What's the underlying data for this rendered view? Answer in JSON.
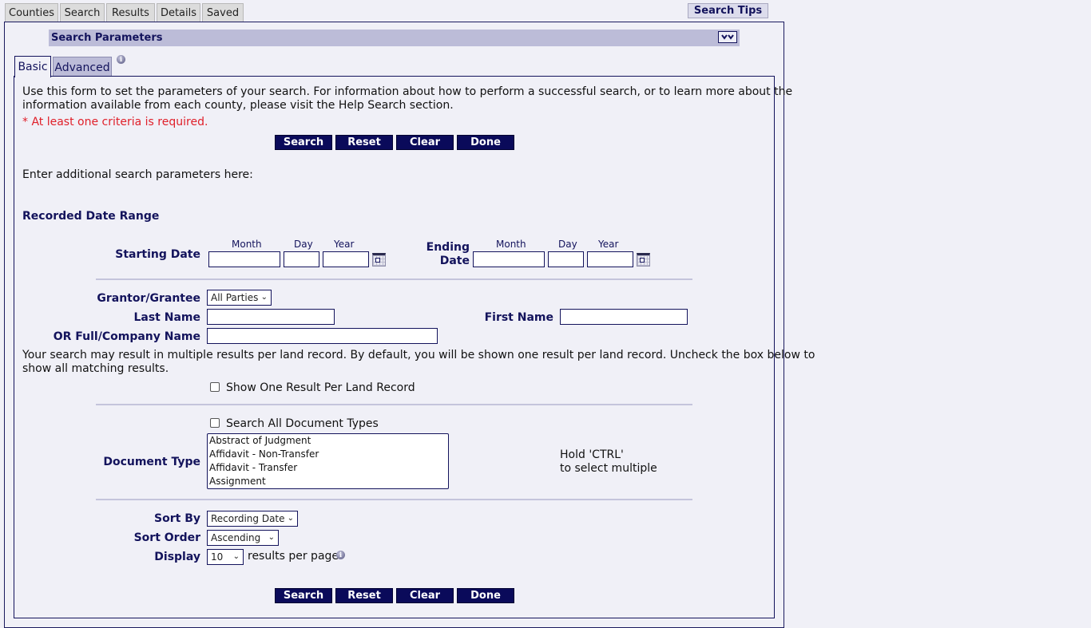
{
  "top_tabs": [
    "Counties",
    "Search",
    "Results",
    "Details",
    "Saved"
  ],
  "search_tips_label": "Search Tips",
  "section": {
    "title": "Search Parameters",
    "collapse_icon": "double-chevron-down-icon"
  },
  "sub_tabs": [
    "Basic",
    "Advanced"
  ],
  "intro": {
    "line1": "Use this form to set the parameters of your search. For information about how to perform a successful search, or to learn more about the",
    "line2": "information available from each county, please visit the Help Search section.",
    "required_note": "* At least one criteria is required."
  },
  "buttons": {
    "search": "Search",
    "reset": "Reset",
    "clear": "Clear",
    "done": "Done"
  },
  "additional_text": "Enter additional search parameters here:",
  "date_range": {
    "heading": "Recorded Date Range",
    "start_label": "Starting Date",
    "end_label_1": "Ending",
    "end_label_2": "Date",
    "month": "Month",
    "day": "Day",
    "year": "Year",
    "start_month": "",
    "start_day": "",
    "start_year": "",
    "end_month": "",
    "end_day": "",
    "end_year": ""
  },
  "party": {
    "grantor_label": "Grantor/Grantee",
    "grantor_value": "All Parties",
    "last_name_label": "Last Name",
    "last_name_value": "",
    "first_name_label": "First Name",
    "first_name_value": "",
    "full_name_label": "OR Full/Company Name",
    "full_name_value": ""
  },
  "results_note": {
    "line1": "Your search may result in multiple results per land record. By default, you will be shown one result per land record. Uncheck the box below to",
    "line2": "show all matching results.",
    "checkbox_label": "Show One Result Per Land Record",
    "checked": false
  },
  "document": {
    "all_types_label": "Search All Document Types",
    "all_types_checked": false,
    "type_label": "Document Type",
    "options": [
      "Abstract of Judgment",
      "Affidavit - Non-Transfer",
      "Affidavit - Transfer",
      "Assignment"
    ],
    "hint1": "Hold 'CTRL'",
    "hint2": "to select multiple"
  },
  "sorting": {
    "sort_by_label": "Sort By",
    "sort_by_value": "Recording Date",
    "sort_order_label": "Sort Order",
    "sort_order_value": "Ascending",
    "display_label": "Display",
    "display_value": "10",
    "per_page_text": "results per page"
  },
  "colors": {
    "navy": "#13135c",
    "button": "#0a0a5a",
    "header_bar": "#bcbcd8",
    "background": "#f0f0f7",
    "required": "#e0202a"
  }
}
